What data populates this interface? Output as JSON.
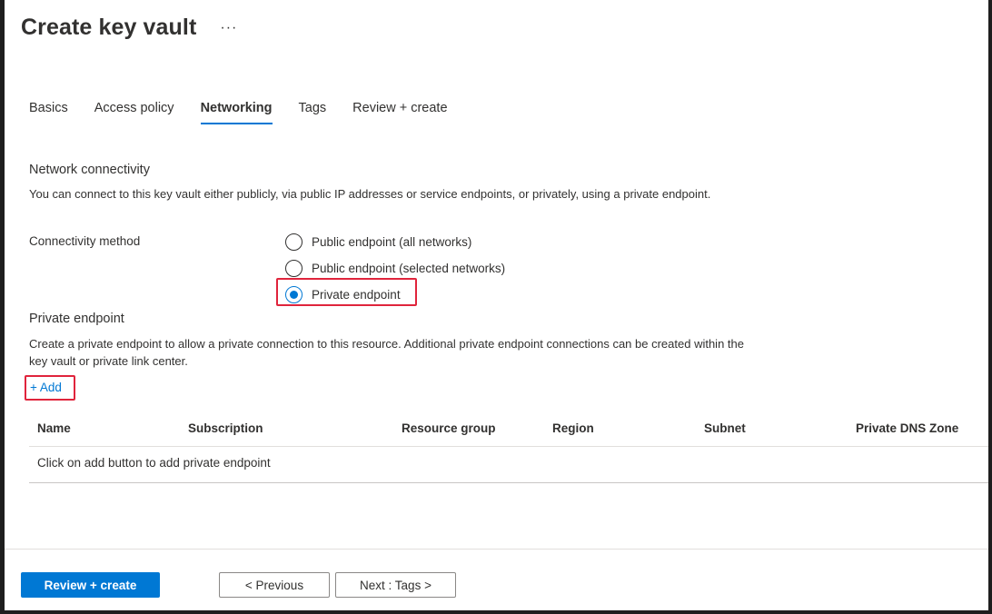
{
  "page": {
    "title": "Create key vault",
    "more_icon": "ellipsis-icon",
    "more_label": "···"
  },
  "tabs": [
    {
      "label": "Basics",
      "active": false
    },
    {
      "label": "Access policy",
      "active": false
    },
    {
      "label": "Networking",
      "active": true
    },
    {
      "label": "Tags",
      "active": false
    },
    {
      "label": "Review + create",
      "active": false
    }
  ],
  "network": {
    "heading": "Network connectivity",
    "description": "You can connect to this key vault either publicly, via public IP addresses or service endpoints, or privately, using a private endpoint.",
    "connectivity_label": "Connectivity method",
    "options": [
      {
        "label": "Public endpoint (all networks)",
        "selected": false
      },
      {
        "label": "Public endpoint (selected networks)",
        "selected": false
      },
      {
        "label": "Private endpoint",
        "selected": true
      }
    ]
  },
  "private_endpoint": {
    "heading": "Private endpoint",
    "description": "Create a private endpoint to allow a private connection to this resource. Additional private endpoint connections can be created within the key vault or private link center.",
    "add_label": "+ Add",
    "columns": [
      "Name",
      "Subscription",
      "Resource group",
      "Region",
      "Subnet",
      "Private DNS Zone"
    ],
    "empty_message": "Click on add button to add private endpoint"
  },
  "footer": {
    "review_create": "Review + create",
    "previous": "< Previous",
    "next": "Next : Tags >"
  },
  "colors": {
    "accent": "#0078d4",
    "highlight": "#e0243c",
    "text": "#323130"
  }
}
